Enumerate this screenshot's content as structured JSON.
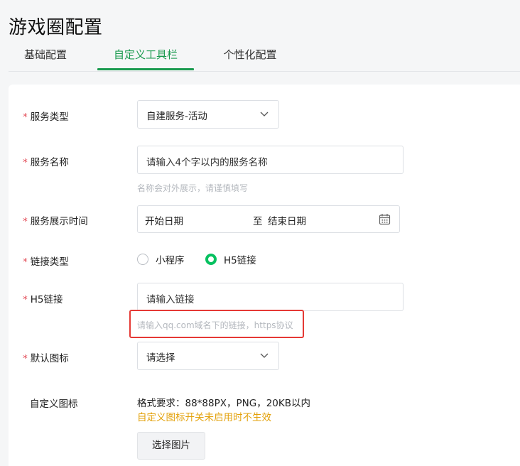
{
  "page": {
    "title": "游戏圈配置"
  },
  "tabs": [
    {
      "label": "基础配置",
      "active": false
    },
    {
      "label": "自定义工具栏",
      "active": true
    },
    {
      "label": "个性化配置",
      "active": false
    }
  ],
  "form": {
    "required_mark": "*",
    "service_type": {
      "label": "服务类型",
      "value": "自建服务-活动"
    },
    "service_name": {
      "label": "服务名称",
      "placeholder": "请输入4个字以内的服务名称",
      "hint": "名称会对外展示，请谨慎填写"
    },
    "display_time": {
      "label": "服务展示时间",
      "start_placeholder": "开始日期",
      "separator": "至",
      "end_placeholder": "结束日期"
    },
    "link_type": {
      "label": "链接类型",
      "options": [
        "小程序",
        "H5链接"
      ],
      "selected": "H5链接"
    },
    "h5_link": {
      "label": "H5链接",
      "placeholder": "请输入链接",
      "hint": "请输入qq.com域名下的链接，https协议"
    },
    "default_icon": {
      "label": "默认图标",
      "value": "请选择"
    },
    "custom_icon": {
      "label": "自定义图标",
      "format": "格式要求：88*88PX，PNG，20KB以内",
      "warning": "自定义图标开关未启用时不生效",
      "button": "选择图片"
    }
  },
  "colors": {
    "accent": "#07c160",
    "tab_active": "#1a9a4f",
    "required": "#e34d59",
    "warning": "#e3a10a",
    "highlight": "#e53935"
  },
  "icons": {
    "select": "chevron-down-icon",
    "date": "calendar-icon"
  }
}
